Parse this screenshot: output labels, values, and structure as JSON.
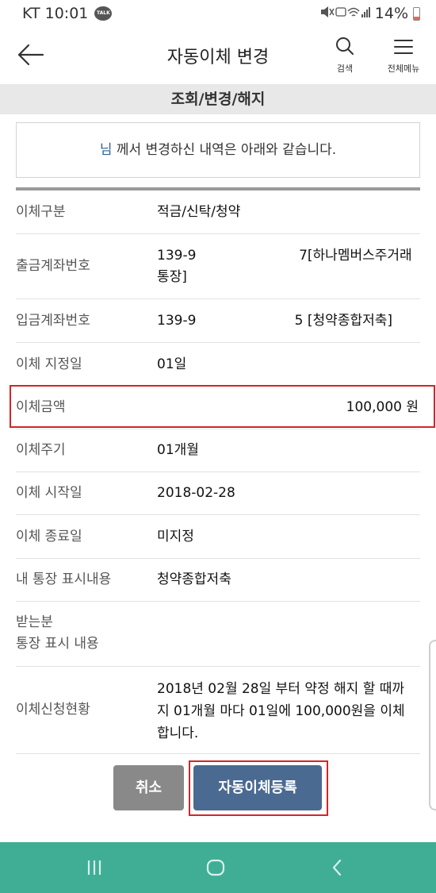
{
  "status_bar": {
    "carrier_time": "KT 10:01",
    "talk_icon_text": "TALK",
    "battery": "14%"
  },
  "header": {
    "title": "자동이체 변경",
    "search_label": "검색",
    "menu_label": "전체메뉴"
  },
  "section": {
    "title": "조회/변경/해지"
  },
  "notice": {
    "name_suffix": "님",
    "text": " 께서 변경하신 내역은 아래와 같습니다."
  },
  "details": [
    {
      "label": "이체구분",
      "value": "적금/신탁/청약"
    },
    {
      "label": "출금계좌번호",
      "value": "139-9                        7[하나멤버스주거래통장]"
    },
    {
      "label": "입금계좌번호",
      "value": "139-9                       5 [청약종합저축]"
    },
    {
      "label": "이체 지정일",
      "value": "01일"
    },
    {
      "label": "이체금액",
      "value": "100,000 원"
    },
    {
      "label": "이체주기",
      "value": "01개월"
    },
    {
      "label": "이체 시작일",
      "value": "2018-02-28"
    },
    {
      "label": "이체 종료일",
      "value": "미지정"
    },
    {
      "label": "내 통장 표시내용",
      "value": "청약종합저축"
    },
    {
      "label": "받는분\n통장 표시 내용",
      "value": ""
    },
    {
      "label": "이체신청현황",
      "value": "2018년 02월 28일 부터 약정 해지 할 때까지 01개월 마다 01일에 100,000원을 이체합니다."
    }
  ],
  "buttons": {
    "cancel": "취소",
    "register": "자동이체등록"
  },
  "colors": {
    "accent_red": "#d4242a",
    "primary_button": "#4a6a92",
    "cancel_button": "#898989",
    "nav_bar": "#3fae95",
    "name_blue": "#2f5f9a"
  }
}
